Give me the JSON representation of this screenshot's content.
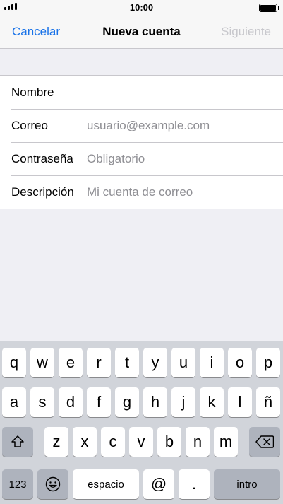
{
  "status_bar": {
    "time": "10:00"
  },
  "nav": {
    "cancel_label": "Cancelar",
    "title": "Nueva cuenta",
    "next_label": "Siguiente",
    "accent_color": "#1a73e8",
    "disabled_color": "#c7c7cc"
  },
  "form": {
    "rows": [
      {
        "label": "Nombre",
        "value": "",
        "placeholder": ""
      },
      {
        "label": "Correo",
        "value": "",
        "placeholder": "usuario@example.com"
      },
      {
        "label": "Contraseña",
        "value": "",
        "placeholder": "Obligatorio"
      },
      {
        "label": "Descripción",
        "value": "",
        "placeholder": "Mi cuenta de correo"
      }
    ]
  },
  "keyboard": {
    "row1": [
      "q",
      "w",
      "e",
      "r",
      "t",
      "y",
      "u",
      "i",
      "o",
      "p"
    ],
    "row2": [
      "a",
      "s",
      "d",
      "f",
      "g",
      "h",
      "j",
      "k",
      "l",
      "ñ"
    ],
    "row3": [
      "z",
      "x",
      "c",
      "v",
      "b",
      "n",
      "m"
    ],
    "numbers_label": "123",
    "space_label": "espacio",
    "at_label": "@",
    "dot_label": ".",
    "return_label": "intro",
    "icons": {
      "shift": "shift-icon",
      "backspace": "backspace-icon",
      "emoji": "emoji-icon"
    }
  }
}
